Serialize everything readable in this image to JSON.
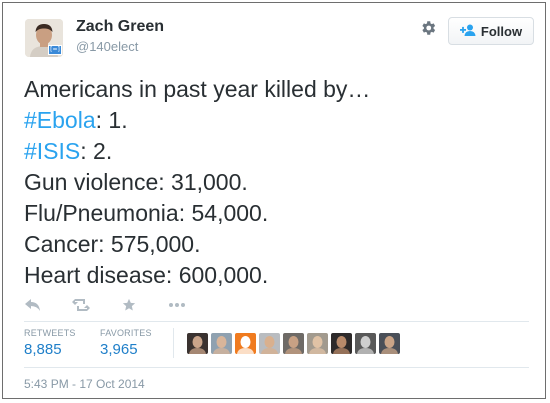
{
  "user": {
    "name": "Zach Green",
    "handle": "@140elect",
    "avatar_badge": "[=]"
  },
  "header": {
    "follow_label": "Follow"
  },
  "tweet": {
    "lines": [
      {
        "text": "Americans in past year killed by…"
      },
      {
        "hashtag": "#Ebola",
        "text": ": 1."
      },
      {
        "hashtag": "#ISIS",
        "text": ": 2."
      },
      {
        "text": "Gun violence: 31,000."
      },
      {
        "text": "Flu/Pneumonia: 54,000."
      },
      {
        "text": "Cancer: 575,000."
      },
      {
        "text": "Heart disease: 600,000."
      }
    ]
  },
  "actions": {
    "reply_icon": "reply-icon",
    "retweet_icon": "retweet-icon",
    "favorite_icon": "star-icon",
    "more_icon": "more-icon"
  },
  "stats": {
    "retweets_label": "RETWEETS",
    "retweets_count": "8,885",
    "favorites_label": "FAVORITES",
    "favorites_count": "3,965"
  },
  "faces": [
    {
      "bg": "#3a3230",
      "skin": "#c9a48a"
    },
    {
      "bg": "#8fa1b0",
      "skin": "#d8b59a"
    },
    {
      "bg": "#f07b1f",
      "skin": "#ffffff"
    },
    {
      "bg": "#b9bcc0",
      "skin": "#d9b08e"
    },
    {
      "bg": "#6e6a66",
      "skin": "#c8a184"
    },
    {
      "bg": "#a29a8e",
      "skin": "#e0c2a5"
    },
    {
      "bg": "#2d2a2a",
      "skin": "#b88a6a"
    },
    {
      "bg": "#595959",
      "skin": "#cfcfcf"
    },
    {
      "bg": "#4a4f58",
      "skin": "#caa487"
    }
  ],
  "timestamp": "5:43 PM - 17 Oct 2014",
  "colors": {
    "link": "#2aa3ef",
    "count": "#1f7fc9",
    "muted": "#8899a6"
  }
}
